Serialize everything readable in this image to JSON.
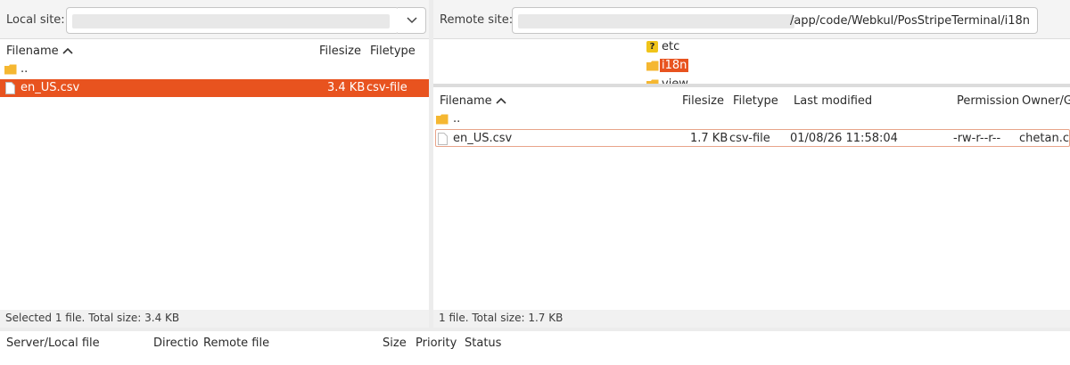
{
  "local": {
    "site_label": "Local site:",
    "path": "",
    "columns": {
      "filename": "Filename",
      "filesize": "Filesize",
      "filetype": "Filetype"
    },
    "rows": [
      {
        "name": "..",
        "size": "",
        "type": "",
        "kind": "folder"
      },
      {
        "name": "en_US.csv",
        "size": "3.4 KB",
        "type": "csv-file",
        "kind": "file"
      }
    ],
    "status": "Selected 1 file. Total size: 3.4 KB"
  },
  "remote": {
    "site_label": "Remote site:",
    "path": "/app/code/Webkul/PosStripeTerminal/i18n",
    "tree": [
      {
        "name": "etc",
        "icon": "unknown-folder-icon"
      },
      {
        "name": "i18n",
        "icon": "folder-icon",
        "selected": true
      },
      {
        "name": "view",
        "icon": "folder-icon"
      }
    ],
    "columns": {
      "filename": "Filename",
      "filesize": "Filesize",
      "filetype": "Filetype",
      "modified": "Last modified",
      "permission": "Permission",
      "owner": "Owner/G"
    },
    "rows": [
      {
        "name": "..",
        "kind": "folder"
      },
      {
        "name": "en_US.csv",
        "size": "1.7 KB",
        "type": "csv-file",
        "modified": "01/08/26 11:58:04",
        "permission": "-rw-r--r--",
        "owner": "chetan.ch",
        "kind": "file"
      }
    ],
    "status": "1 file. Total size: 1.7 KB"
  },
  "queue": {
    "columns": {
      "server": "Server/Local file",
      "direction": "Directio",
      "remote": "Remote file",
      "size": "Size",
      "priority": "Priority",
      "status": "Status"
    }
  },
  "colors": {
    "selection": "#e8531f",
    "folder": "#f5b731",
    "outline": "#e8a48a"
  }
}
